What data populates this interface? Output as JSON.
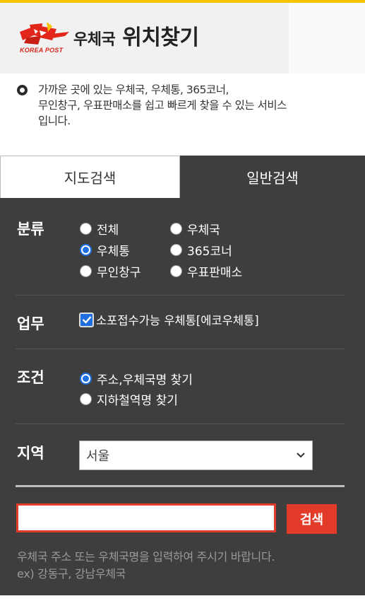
{
  "header": {
    "logo_caption": "KOREA POST",
    "title_small": "우체국",
    "title_large": "위치찾기"
  },
  "intro": {
    "line1": "가까운 곳에 있는 우체국, 우체통, 365코너,",
    "line2": "무인창구, 우표판매소를 쉽고 빠르게 찾을 수 있는 서비스",
    "line3": "입니다."
  },
  "tabs": [
    {
      "label": "지도검색",
      "active": false
    },
    {
      "label": "일반검색",
      "active": true
    }
  ],
  "form": {
    "category": {
      "label": "분류",
      "options": [
        {
          "label": "전체",
          "checked": false
        },
        {
          "label": "우체국",
          "checked": false
        },
        {
          "label": "우체통",
          "checked": true
        },
        {
          "label": "365코너",
          "checked": false
        },
        {
          "label": "무인창구",
          "checked": false
        },
        {
          "label": "우표판매소",
          "checked": false
        }
      ]
    },
    "service": {
      "label": "업무",
      "checkbox_label": "소포접수가능 우체통[에코우체통]",
      "checked": true
    },
    "condition": {
      "label": "조건",
      "options": [
        {
          "label": "주소,우체국명 찾기",
          "checked": true
        },
        {
          "label": "지하철역명 찾기",
          "checked": false
        }
      ]
    },
    "region": {
      "label": "지역",
      "selected": "서울"
    },
    "search": {
      "value": "",
      "button_label": "검색"
    },
    "help": {
      "line1": "우체국 주소 또는 우체국명을 입력하여 주시기 바랍니다.",
      "line2": "ex) 강동구, 강남우체국"
    }
  },
  "colors": {
    "accent_yellow": "#f4c400",
    "panel_bg": "#3e3e3e",
    "search_red": "#e23b2a",
    "radio_blue": "#1f6fe0"
  }
}
